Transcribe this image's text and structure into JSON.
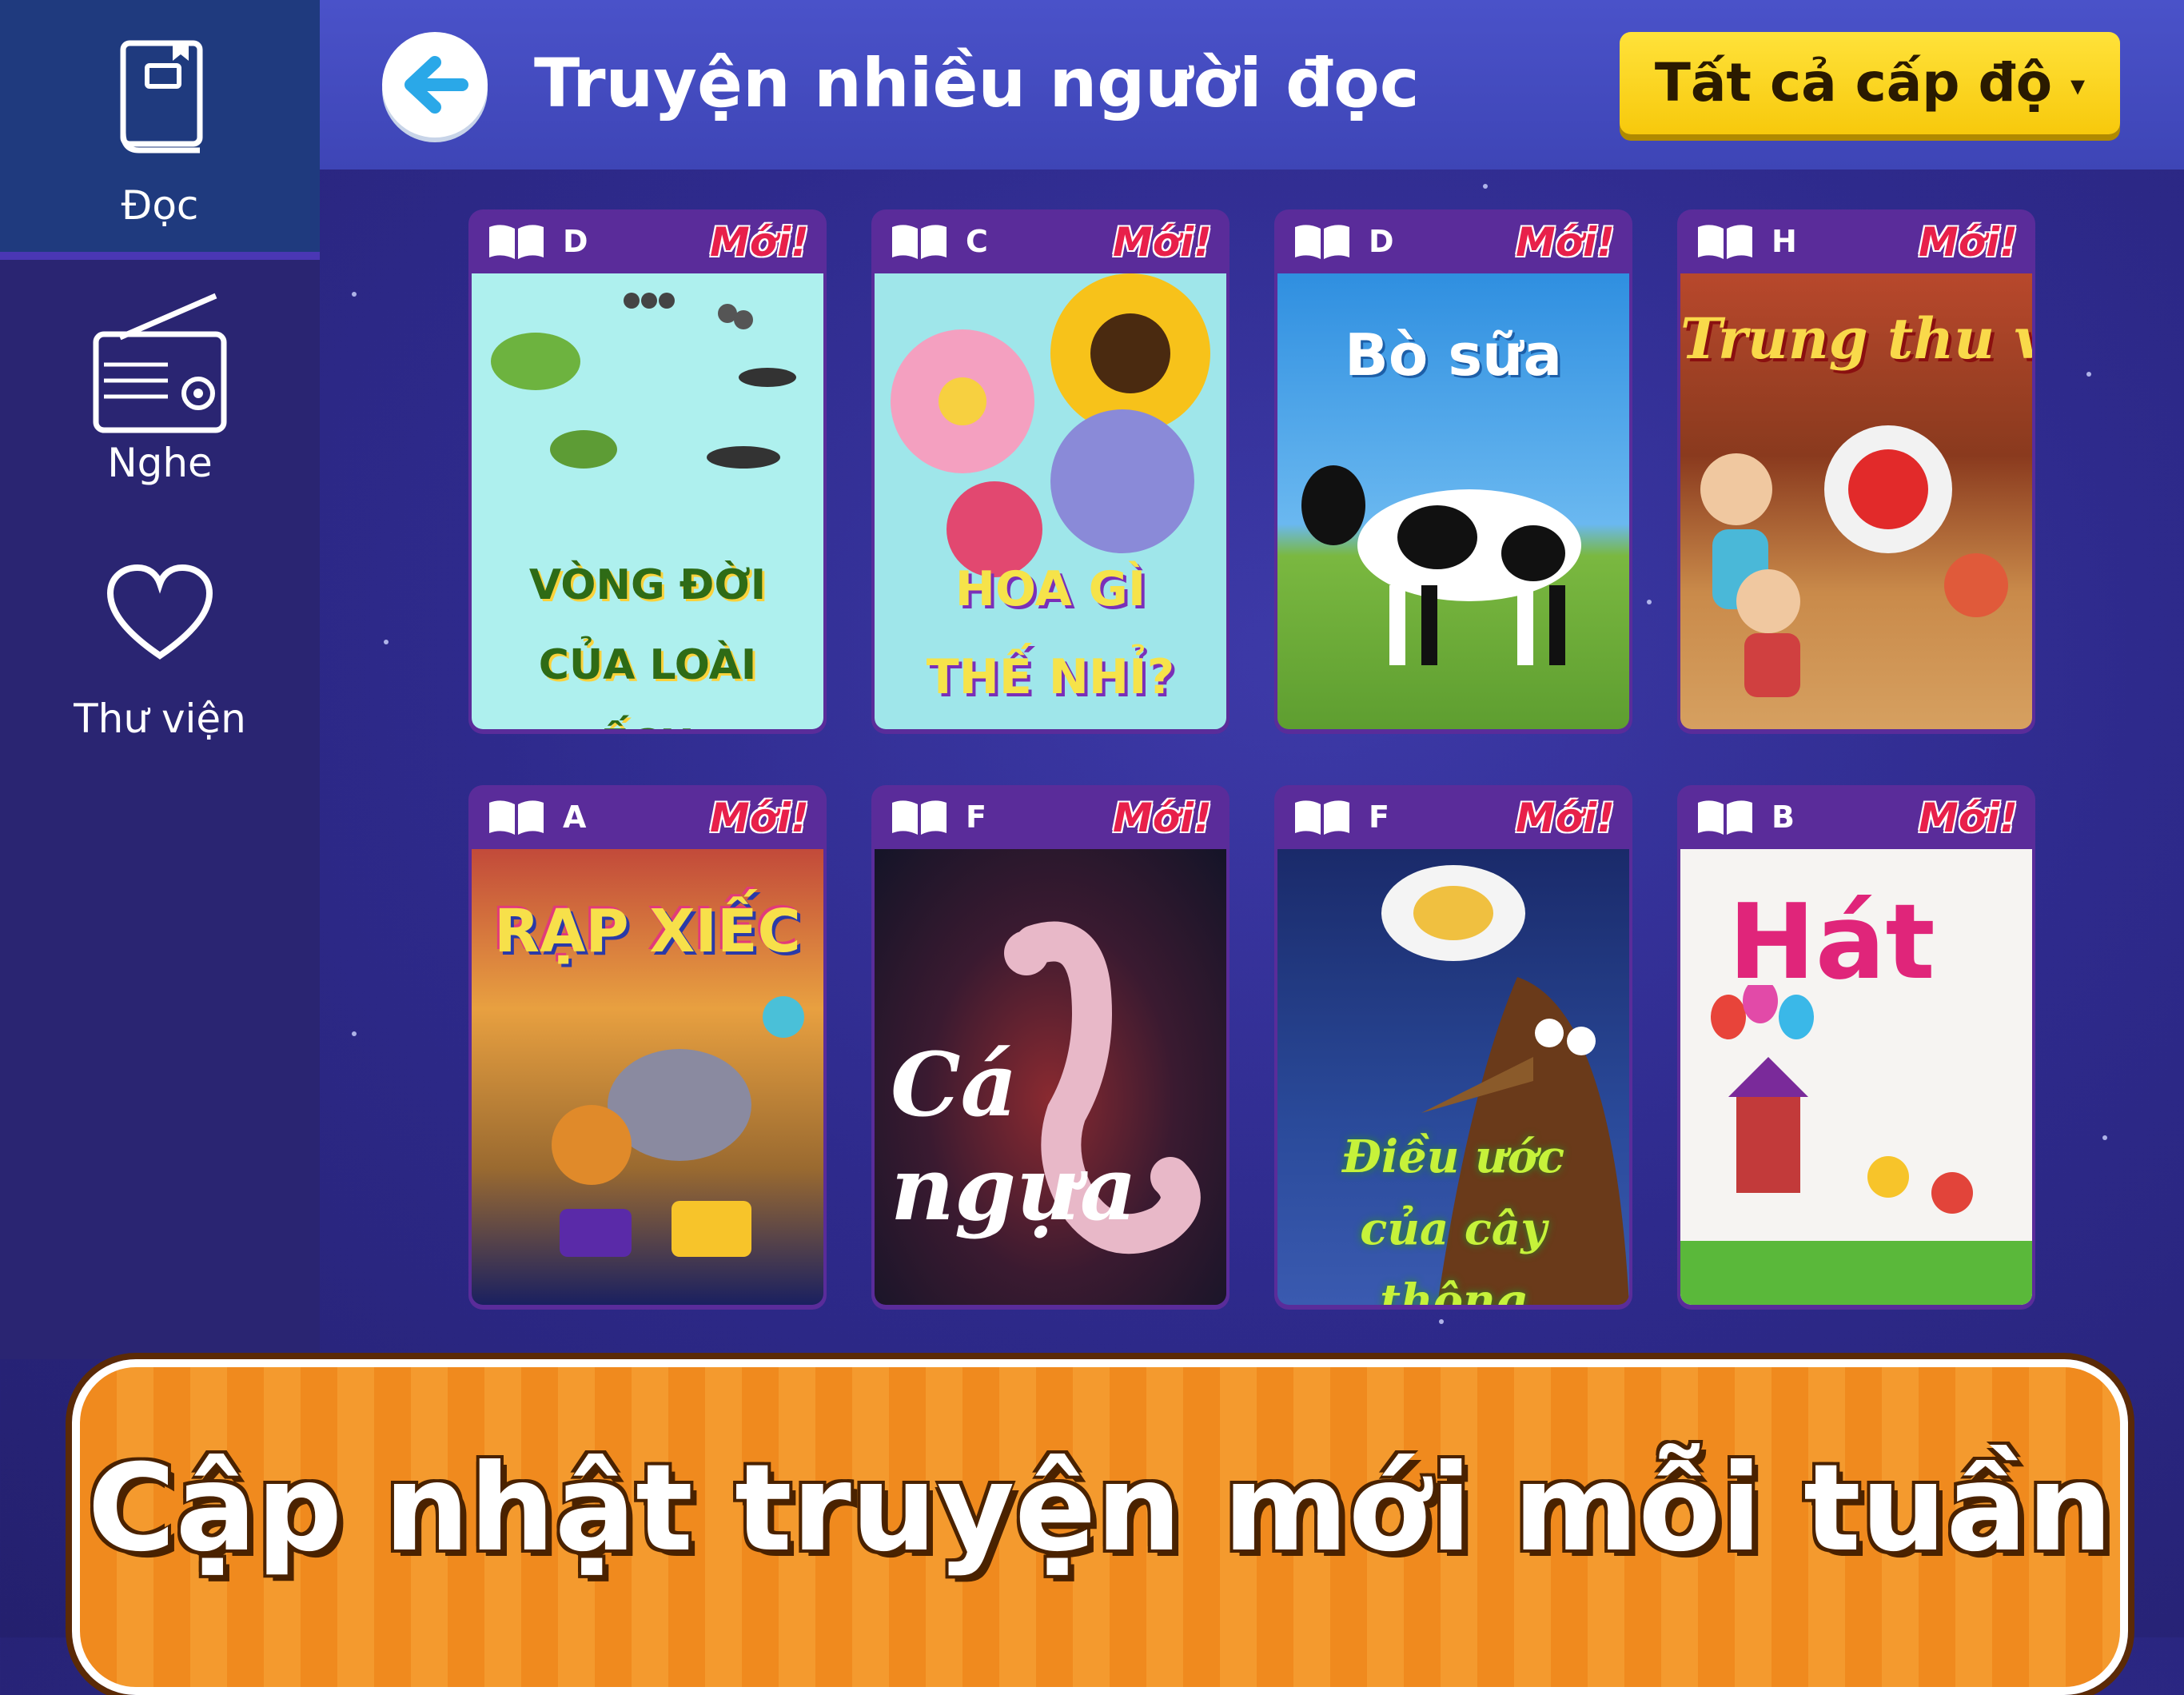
{
  "sidebar": {
    "items": [
      {
        "label": "Đọc",
        "icon": "book-icon",
        "active": true
      },
      {
        "label": "Nghe",
        "icon": "radio-icon",
        "active": false
      },
      {
        "label": "Thư viện",
        "icon": "heart-icon",
        "active": false
      }
    ]
  },
  "header": {
    "back_icon": "arrow-left-icon",
    "title": "Truyện nhiều người đọc",
    "level_filter": "Tất cả cấp độ",
    "level_caret": "▾"
  },
  "books": [
    {
      "level": "D",
      "badge": "Mới!",
      "title": "VÒNG ĐỜI CỦA LOÀI ẾCH"
    },
    {
      "level": "C",
      "badge": "Mới!",
      "title": "HOA GÌ THẾ NHỈ?"
    },
    {
      "level": "D",
      "badge": "Mới!",
      "title": "Bò sữa"
    },
    {
      "level": "H",
      "badge": "Mới!",
      "title": "Trung thu về"
    },
    {
      "level": "A",
      "badge": "Mới!",
      "title": "RẠP XIẾC"
    },
    {
      "level": "F",
      "badge": "Mới!",
      "title": "Cá ngựa"
    },
    {
      "level": "F",
      "badge": "Mới!",
      "title": "Điều ước của cây thông"
    },
    {
      "level": "B",
      "badge": "Mới!",
      "title": "Hát"
    }
  ],
  "banner": {
    "text": "Cập nhật truyện mới mỗi tuần"
  },
  "colors": {
    "background": "#2e2a8c",
    "sidebar_active": "#1f3a7e",
    "header": "#4a52c9",
    "level_button": "#f7c90c",
    "new_badge": "#e8204a",
    "banner": "#f08a1e"
  }
}
